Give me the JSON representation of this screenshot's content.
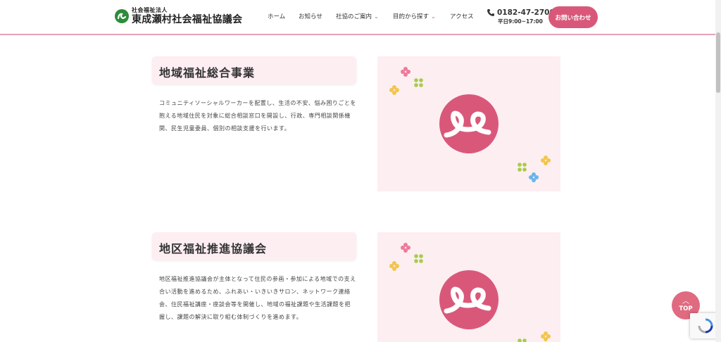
{
  "header": {
    "logo_sub": "社会福祉法人",
    "logo_main": "東成瀬村社会福祉協議会",
    "nav": [
      {
        "label": "ホーム",
        "dropdown": false
      },
      {
        "label": "お知らせ",
        "dropdown": false
      },
      {
        "label": "社協のご案内",
        "dropdown": true
      },
      {
        "label": "目的から探す",
        "dropdown": true
      },
      {
        "label": "アクセス",
        "dropdown": false
      }
    ],
    "phone": "0182-47-2700",
    "hours": "平日9:00~17:00",
    "contact_label": "お問い合わせ"
  },
  "sections": [
    {
      "title": "地域福祉総合事業",
      "desc": "コミュニティソーシャルワーカーを配置し、生活の不安、悩み困りごとを抱える地域住民を対象に総合相談窓口を開設し、行政、専門相談関係機関、民生児童委員、個別の相談支援を行います。"
    },
    {
      "title": "地区福祉推進協議会",
      "desc": "地区福祉推進協議会が主体となって住民の参画・参加による地域での支え合い活動を進めるため、ふれあい・いきいきサロン、ネットワーク連絡会、住民福祉講座・座談会等を開催し、地域の福祉課題や生活課題を把握し、課題の解決に取り組む体制づくりを進めます。"
    }
  ],
  "top_button": {
    "label": "TOP"
  },
  "colors": {
    "accent": "#d9587a",
    "panel": "#fdeef2",
    "header_line": "#e8a0b4",
    "logo_green": "#2e8b3a",
    "dot_pink": "#ee7a9a",
    "dot_yellow": "#f2c64a",
    "dot_green": "#a8cc48",
    "dot_blue": "#6ab4ee"
  },
  "icons": [
    "logo-mark-icon",
    "phone-icon",
    "chevron-down-icon",
    "emblem-icon",
    "arrow-up-icon",
    "recaptcha-icon"
  ]
}
